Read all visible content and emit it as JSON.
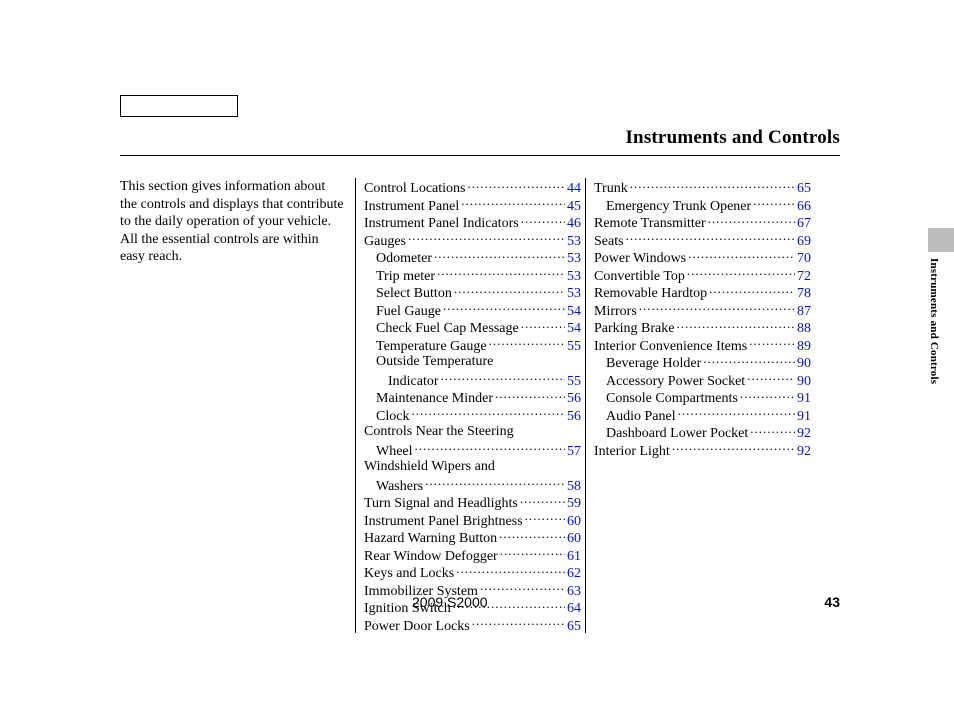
{
  "section_title": "Instruments and Controls",
  "intro": "This section gives information about the controls and displays that contribute to the daily operation of your vehicle. All the essential controls are within easy reach.",
  "toc_col1": [
    {
      "label": "Control Locations",
      "page": "44",
      "indent": 0
    },
    {
      "label": "Instrument Panel",
      "page": "45",
      "indent": 0
    },
    {
      "label": "Instrument Panel Indicators",
      "page": "46",
      "indent": 0
    },
    {
      "label": "Gauges",
      "page": "53",
      "indent": 0
    },
    {
      "label": "Odometer",
      "page": "53",
      "indent": 1
    },
    {
      "label": "Trip meter",
      "page": "53",
      "indent": 1
    },
    {
      "label": "Select Button",
      "page": "53",
      "indent": 1
    },
    {
      "label": "Fuel Gauge",
      "page": "54",
      "indent": 1
    },
    {
      "label": "Check Fuel Cap Message",
      "page": "54",
      "indent": 1
    },
    {
      "label": "Temperature Gauge",
      "page": "55",
      "indent": 1
    },
    {
      "label": "Outside Temperature",
      "page": "",
      "indent": 1,
      "nowrap_page": true
    },
    {
      "label": "Indicator",
      "page": "55",
      "indent": 2
    },
    {
      "label": "Maintenance Minder",
      "page": "56",
      "indent": 1
    },
    {
      "label": "Clock",
      "page": "56",
      "indent": 1
    },
    {
      "label": "Controls Near the Steering",
      "page": "",
      "indent": 0,
      "nowrap_page": true
    },
    {
      "label": "Wheel",
      "page": "57",
      "indent": 1
    },
    {
      "label": "Windshield Wipers and",
      "page": "",
      "indent": 0,
      "nowrap_page": true
    },
    {
      "label": "Washers",
      "page": "58",
      "indent": 1
    },
    {
      "label": "Turn Signal and Headlights",
      "page": "59",
      "indent": 0
    },
    {
      "label": "Instrument Panel Brightness",
      "page": "60",
      "indent": 0
    },
    {
      "label": "Hazard Warning Button",
      "page": "60",
      "indent": 0
    },
    {
      "label": "Rear Window Defogger",
      "page": "61",
      "indent": 0
    },
    {
      "label": "Keys and Locks",
      "page": "62",
      "indent": 0
    },
    {
      "label": "Immobilizer System",
      "page": "63",
      "indent": 0
    },
    {
      "label": "Ignition Switch",
      "page": "64",
      "indent": 0
    },
    {
      "label": "Power Door Locks",
      "page": "65",
      "indent": 0
    }
  ],
  "toc_col2": [
    {
      "label": "Trunk",
      "page": "65",
      "indent": 0
    },
    {
      "label": "Emergency Trunk Opener",
      "page": "66",
      "indent": 1
    },
    {
      "label": "Remote Transmitter",
      "page": "67",
      "indent": 0
    },
    {
      "label": "Seats",
      "page": "69",
      "indent": 0
    },
    {
      "label": "Power Windows",
      "page": "70",
      "indent": 0
    },
    {
      "label": "Convertible Top",
      "page": "72",
      "indent": 0
    },
    {
      "label": "Removable Hardtop",
      "page": "78",
      "indent": 0
    },
    {
      "label": "Mirrors",
      "page": "87",
      "indent": 0
    },
    {
      "label": "Parking Brake",
      "page": "88",
      "indent": 0
    },
    {
      "label": "Interior Convenience Items",
      "page": "89",
      "indent": 0
    },
    {
      "label": "Beverage Holder",
      "page": "90",
      "indent": 1
    },
    {
      "label": "Accessory Power Socket",
      "page": "90",
      "indent": 1
    },
    {
      "label": "Console Compartments",
      "page": "91",
      "indent": 1
    },
    {
      "label": "Audio Panel",
      "page": "91",
      "indent": 1
    },
    {
      "label": "Dashboard Lower Pocket",
      "page": "92",
      "indent": 1
    },
    {
      "label": "Interior Light",
      "page": "92",
      "indent": 0
    }
  ],
  "footer_model": "2009  S2000",
  "footer_page": "43",
  "side_tab": "Instruments and Controls"
}
